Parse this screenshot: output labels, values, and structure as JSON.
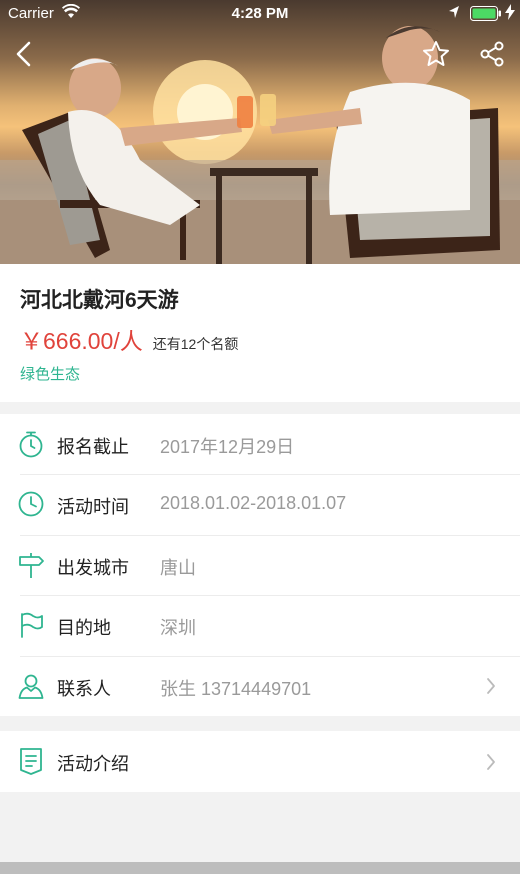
{
  "status_bar": {
    "carrier": "Carrier",
    "time": "4:28 PM",
    "battery_color": "#4cd964"
  },
  "header": {
    "back_icon": "chevron-left-icon",
    "favorite_icon": "star-outline-icon",
    "share_icon": "share-icon"
  },
  "activity": {
    "title": "河北北戴河6天游",
    "price": "￥666.00",
    "price_unit": "/人",
    "quota": "还有12个名额",
    "tag": "绿色生态"
  },
  "details": [
    {
      "icon": "stopwatch-icon",
      "label": "报名截止",
      "value": "2017年12月29日"
    },
    {
      "icon": "clock-icon",
      "label": "活动时间",
      "value": "2018.01.02-2018.01.07"
    },
    {
      "icon": "signpost-icon",
      "label": "出发城市",
      "value": "唐山"
    },
    {
      "icon": "flag-icon",
      "label": "目的地",
      "value": "深圳"
    },
    {
      "icon": "person-icon",
      "label": "联系人",
      "value": "张生 13714449701"
    }
  ],
  "intro": {
    "icon": "document-icon",
    "label": "活动介绍"
  },
  "colors": {
    "accent": "#2fb590",
    "price": "#e0433b",
    "label": "#222222",
    "value": "#9a9a9a"
  }
}
